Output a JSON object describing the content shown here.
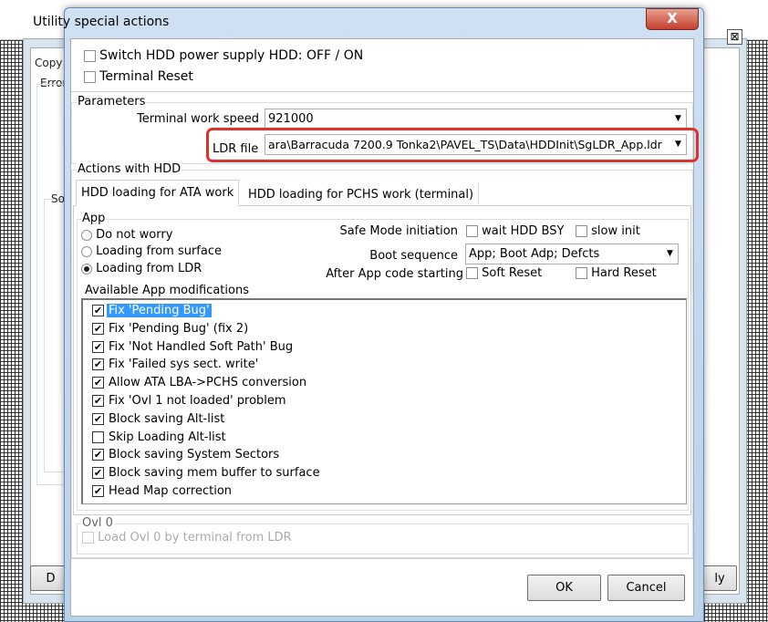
{
  "background": {
    "frag_copy": "Copy",
    "frag_error": "Error",
    "frag_so": "So",
    "frag_d": "D",
    "frag_apply": "ly",
    "close_glyph": "⊠"
  },
  "dialog": {
    "title": "Utility special actions",
    "close_glyph": "X",
    "top_checks": [
      {
        "label": "Switch HDD power supply HDD: OFF / ON",
        "checked": false
      },
      {
        "label": "Terminal Reset",
        "checked": false
      }
    ],
    "parameters": {
      "label": "Parameters",
      "speed_label": "Terminal work speed",
      "speed_value": "921000",
      "ldr_label": "LDR file",
      "ldr_value": "ara\\Barracuda 7200.9 Tonka2\\PAVEL_TS\\Data\\HDDInit\\SgLDR_App.ldr",
      "highlight_color": "#e0302a"
    },
    "actions": {
      "label": "Actions with HDD",
      "tabs": [
        {
          "label": "HDD loading for ATA work",
          "selected": true
        },
        {
          "label": "HDD loading for PCHS work (terminal)",
          "selected": false
        }
      ]
    },
    "app": {
      "label": "App",
      "radios": [
        {
          "label": "Do not worry",
          "checked": false
        },
        {
          "label": "Loading from surface",
          "checked": false
        },
        {
          "label": "Loading from LDR",
          "checked": true
        }
      ],
      "safe_mode_label": "Safe Mode initiation",
      "wait_hdd_bsy": "wait HDD BSY",
      "slow_init": "slow init",
      "boot_label": "Boot sequence",
      "boot_value": "App; Boot Adp; Defcts",
      "after_label": "After App code starting",
      "soft_reset": "Soft Reset",
      "hard_reset": "Hard Reset",
      "mods_label": "Available App modifications",
      "mods": [
        {
          "label": "Fix 'Pending Bug'",
          "checked": true,
          "selected": true
        },
        {
          "label": "Fix 'Pending Bug' (fix 2)",
          "checked": true
        },
        {
          "label": "Fix 'Not Handled Soft Path' Bug",
          "checked": true
        },
        {
          "label": "Fix 'Failed sys sect. write'",
          "checked": true
        },
        {
          "label": "Allow ATA LBA->PCHS conversion",
          "checked": true
        },
        {
          "label": "Fix 'Ovl 1 not loaded' problem",
          "checked": true
        },
        {
          "label": "Block saving Alt-list",
          "checked": true
        },
        {
          "label": "Skip Loading Alt-list",
          "checked": false
        },
        {
          "label": "Block saving System Sectors",
          "checked": true
        },
        {
          "label": "Block saving mem buffer to surface",
          "checked": true
        },
        {
          "label": "Head Map correction",
          "checked": true
        }
      ]
    },
    "ovl": {
      "label": "Ovl 0",
      "check_label": "Load Ovl 0 by terminal from LDR",
      "disabled": true
    },
    "ok": "OK",
    "cancel": "Cancel"
  }
}
